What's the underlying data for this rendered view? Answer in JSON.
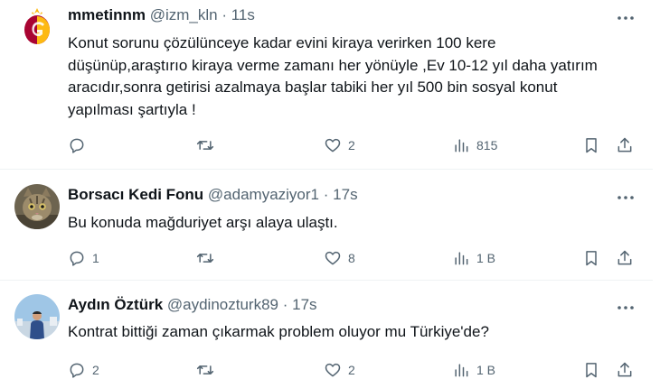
{
  "tweets": [
    {
      "name": "mmetinnm",
      "handle": "@izm_kln",
      "separator": "·",
      "time": "11s",
      "text": "Konut sorunu çözülünceye kadar evini kiraya verirken 100 kere düşünüp,araştırıo kiraya verme zamanı her yönüyle ,Ev 10-12 yıl daha yatırım aracıdır,sonra getirisi azalmaya başlar tabiki her yıl 500 bin sosyal konut yapılması şartıyla !",
      "replies": "",
      "retweets": "",
      "likes": "2",
      "views": "815",
      "avatar": "galatasaray-logo"
    },
    {
      "name": "Borsacı Kedi Fonu",
      "handle": "@adamyaziyor1",
      "separator": "·",
      "time": "17s",
      "text": "Bu konuda mağduriyet arşı alaya ulaştı.",
      "replies": "1",
      "retweets": "",
      "likes": "8",
      "views": "1 B",
      "avatar": "cat-photo"
    },
    {
      "name": "Aydın Öztürk",
      "handle": "@aydinozturk89",
      "separator": "·",
      "time": "17s",
      "text": "Kontrat bittiği zaman çıkarmak problem oluyor mu Türkiye'de?",
      "replies": "2",
      "retweets": "",
      "likes": "2",
      "views": "1 B",
      "avatar": "person-photo"
    }
  ],
  "icons": {
    "more": "more-dots-icon",
    "reply": "reply-icon",
    "retweet": "retweet-icon",
    "like": "heart-icon",
    "views": "views-icon",
    "bookmark": "bookmark-icon",
    "share": "share-icon"
  },
  "colors": {
    "text": "#0f1419",
    "secondary": "#536471",
    "divider": "#eff3f4",
    "galatasaray_red": "#a90432",
    "galatasaray_yellow": "#fdb912"
  }
}
